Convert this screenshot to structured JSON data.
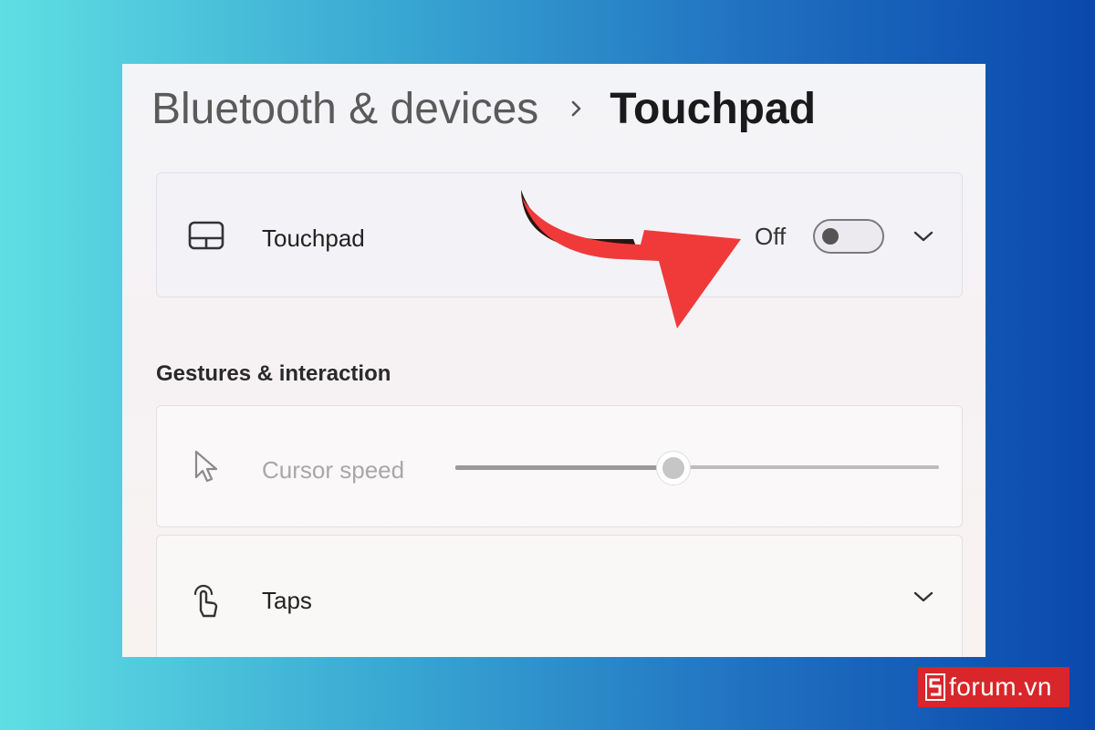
{
  "breadcrumb": {
    "parent": "Bluetooth & devices",
    "separator_icon": "chevron-right-icon",
    "current": "Touchpad"
  },
  "touchpad_setting": {
    "icon": "touchpad-icon",
    "label": "Touchpad",
    "state_text": "Off",
    "toggle_on": false,
    "expand_icon": "chevron-down-icon"
  },
  "gestures_section": {
    "title": "Gestures & interaction"
  },
  "cursor_speed": {
    "icon": "cursor-icon",
    "label": "Cursor speed",
    "disabled": true,
    "slider_value": 0.45
  },
  "taps": {
    "icon": "tap-hand-icon",
    "label": "Taps",
    "expand_icon": "chevron-down-icon"
  },
  "annotation": {
    "icon": "red-curved-arrow",
    "color": "#f03a3a"
  },
  "watermark": {
    "logo_letter": "S",
    "text": "forum.vn",
    "color": "#d8262b"
  }
}
